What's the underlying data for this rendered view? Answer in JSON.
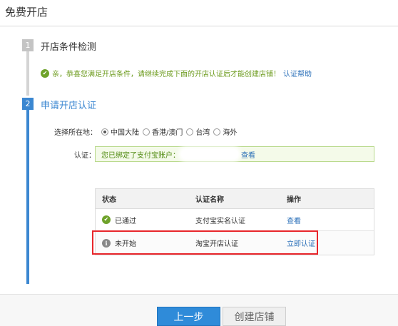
{
  "page": {
    "title": "免费开店"
  },
  "steps": [
    {
      "num": "1",
      "title": "开店条件检测",
      "state": "done"
    },
    {
      "num": "2",
      "title": "申请开店认证",
      "state": "active"
    }
  ],
  "step1": {
    "message": "亲，恭喜您满足开店条件，请继续完成下面的开店认证后才能创建店铺！",
    "help_link": "认证帮助"
  },
  "region": {
    "label": "选择所在地：",
    "options": [
      "中国大陆",
      "香港/澳门",
      "台湾",
      "海外"
    ],
    "selected": "中国大陆"
  },
  "certification": {
    "label": "认证：",
    "bound_text": "您已绑定了支付宝账户：",
    "view_link": "查看"
  },
  "table": {
    "headers": [
      "状态",
      "认证名称",
      "操作"
    ],
    "rows": [
      {
        "status": "已通过",
        "name": "支付宝实名认证",
        "action": "查看"
      },
      {
        "status": "未开始",
        "name": "淘宝开店认证",
        "action": "立即认证"
      }
    ]
  },
  "buttons": {
    "prev": "上一步",
    "create": "创建店铺"
  },
  "colors": {
    "accent": "#3b87d1",
    "success": "#6ea22a",
    "highlight": "#e8262b"
  }
}
